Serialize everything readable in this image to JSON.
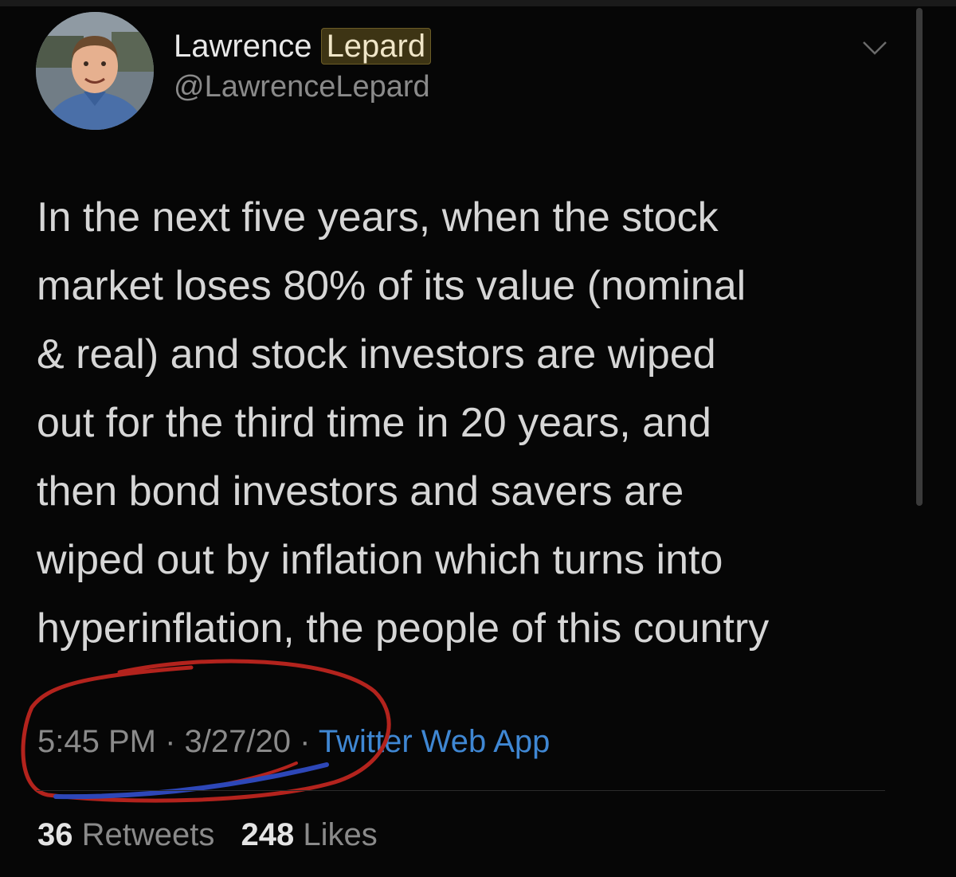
{
  "tweet": {
    "author": {
      "name_first": "Lawrence",
      "name_last": "Lepard",
      "handle": "@LawrenceLepard",
      "avatar_icon": "profile-photo"
    },
    "lines": [
      "In the next five years, when the stock",
      "market loses 80% of its value (nominal",
      "& real) and stock investors are wiped",
      "out for the third time in 20 years, and",
      "then bond investors and savers are",
      "wiped out by inflation which turns into",
      "hyperinflation, the people of this country"
    ],
    "meta": {
      "time": "5:45 PM",
      "separator": "·",
      "date": "3/27/20",
      "source": "Twitter Web App"
    },
    "stats": {
      "retweets_count": "36",
      "retweets_label": "Retweets",
      "likes_count": "248",
      "likes_label": "Likes"
    }
  },
  "ui": {
    "menu_icon": "chevron-down-icon"
  },
  "colors": {
    "background": "#060606",
    "text": "#d6d6d6",
    "secondary": "#8a8a8a",
    "link": "#3f87d3",
    "annotation_red": "#b3231d",
    "annotation_blue": "#2d47b8"
  }
}
